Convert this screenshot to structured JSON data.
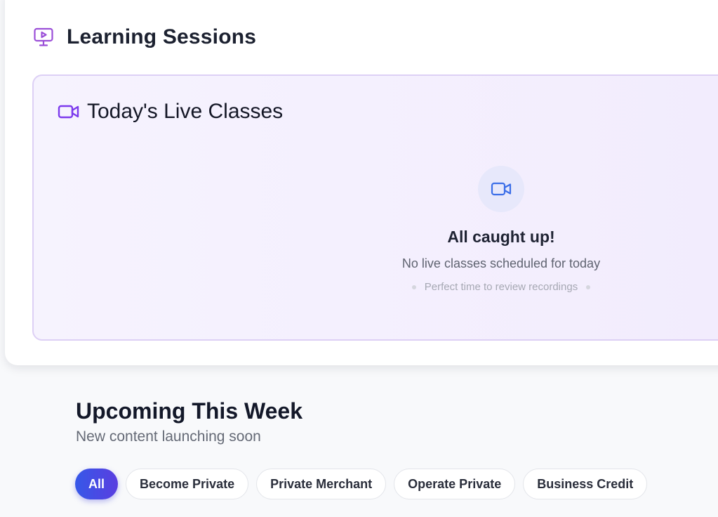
{
  "sessions": {
    "title": "Learning Sessions",
    "icon": "monitor-play-icon",
    "accent_color": "#9b4fd8"
  },
  "live_classes": {
    "title": "Today's Live Classes",
    "icon": "video-camera-icon",
    "icon_color": "#7c3aed",
    "empty_state": {
      "icon": "video-camera-icon",
      "icon_color": "#3b6ee8",
      "title": "All caught up!",
      "subtitle": "No live classes scheduled for today",
      "hint": "Perfect time to review recordings"
    }
  },
  "upcoming": {
    "title": "Upcoming This Week",
    "subtitle": "New content launching soon",
    "filters": [
      {
        "label": "All",
        "active": true
      },
      {
        "label": "Become Private",
        "active": false
      },
      {
        "label": "Private Merchant",
        "active": false
      },
      {
        "label": "Operate Private",
        "active": false
      },
      {
        "label": "Business Credit",
        "active": false
      }
    ]
  }
}
